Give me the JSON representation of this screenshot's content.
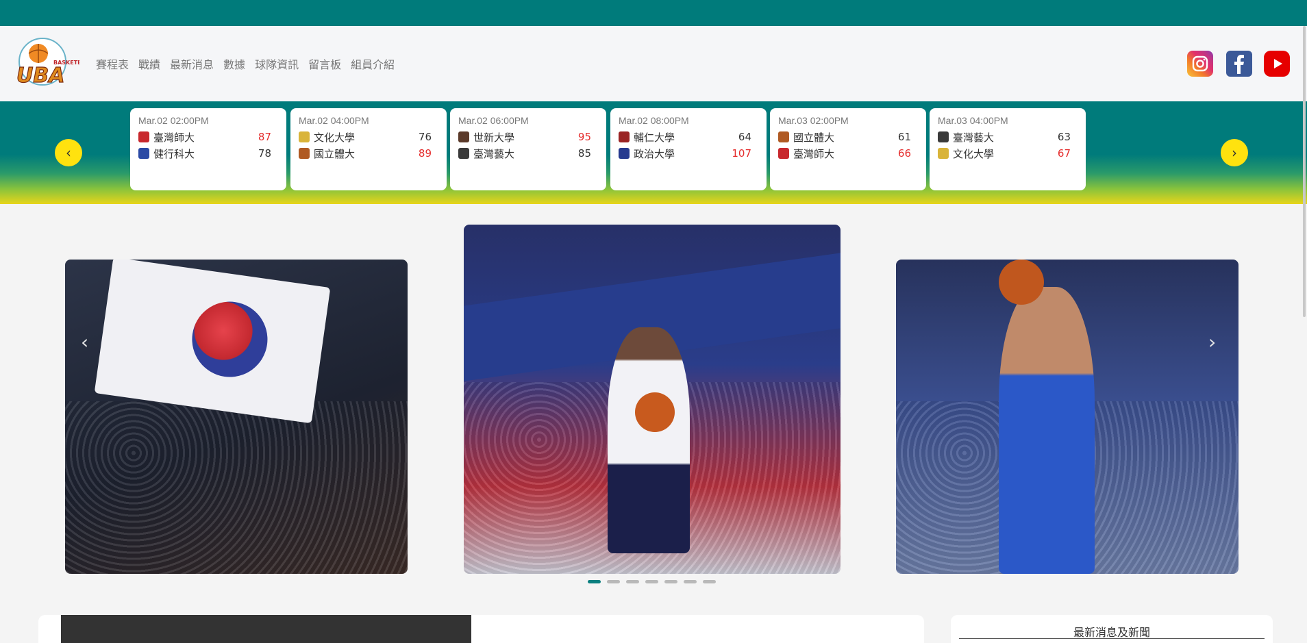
{
  "nav": {
    "items": [
      "賽程表",
      "戰績",
      "最新消息",
      "數據",
      "球隊資訊",
      "留言板",
      "組員介紹"
    ]
  },
  "logo": {
    "text": "UBA",
    "subtext": "BASKETBALL"
  },
  "social": {
    "icons": [
      "instagram-icon",
      "facebook-icon",
      "youtube-icon"
    ]
  },
  "scoreboard": {
    "prev_label": "‹",
    "next_label": "›",
    "games": [
      {
        "time": "Mar.02 02:00PM",
        "teams": [
          {
            "name": "臺灣師大",
            "score": 87,
            "win": true,
            "color": "#c8282d"
          },
          {
            "name": "健行科大",
            "score": 78,
            "win": false,
            "color": "#2b4aa5"
          }
        ]
      },
      {
        "time": "Mar.02 04:00PM",
        "teams": [
          {
            "name": "文化大學",
            "score": 76,
            "win": false,
            "color": "#d9b43a"
          },
          {
            "name": "國立體大",
            "score": 89,
            "win": true,
            "color": "#b05a23"
          }
        ]
      },
      {
        "time": "Mar.02 06:00PM",
        "teams": [
          {
            "name": "世新大學",
            "score": 95,
            "win": true,
            "color": "#5b3a2a"
          },
          {
            "name": "臺灣藝大",
            "score": 85,
            "win": false,
            "color": "#3a3a3a"
          }
        ]
      },
      {
        "time": "Mar.02 08:00PM",
        "teams": [
          {
            "name": "輔仁大學",
            "score": 64,
            "win": false,
            "color": "#9a2323"
          },
          {
            "name": "政治大學",
            "score": 107,
            "win": true,
            "color": "#263a8f"
          }
        ]
      },
      {
        "time": "Mar.03 02:00PM",
        "teams": [
          {
            "name": "國立體大",
            "score": 61,
            "win": false,
            "color": "#b05a23"
          },
          {
            "name": "臺灣師大",
            "score": 66,
            "win": true,
            "color": "#c8282d"
          }
        ]
      },
      {
        "time": "Mar.03 04:00PM",
        "teams": [
          {
            "name": "臺灣藝大",
            "score": 63,
            "win": false,
            "color": "#3a3a3a"
          },
          {
            "name": "文化大學",
            "score": 67,
            "win": true,
            "color": "#d9b43a"
          }
        ]
      }
    ]
  },
  "carousel": {
    "indicator_count": 7,
    "active_index": 0,
    "prev_label": "‹",
    "next_label": "›"
  },
  "news": {
    "title": "最新消息及新聞"
  },
  "colors": {
    "brand_teal": "#007b7b",
    "accent_yellow": "#ffe20f",
    "win_red": "#e52d2d"
  }
}
